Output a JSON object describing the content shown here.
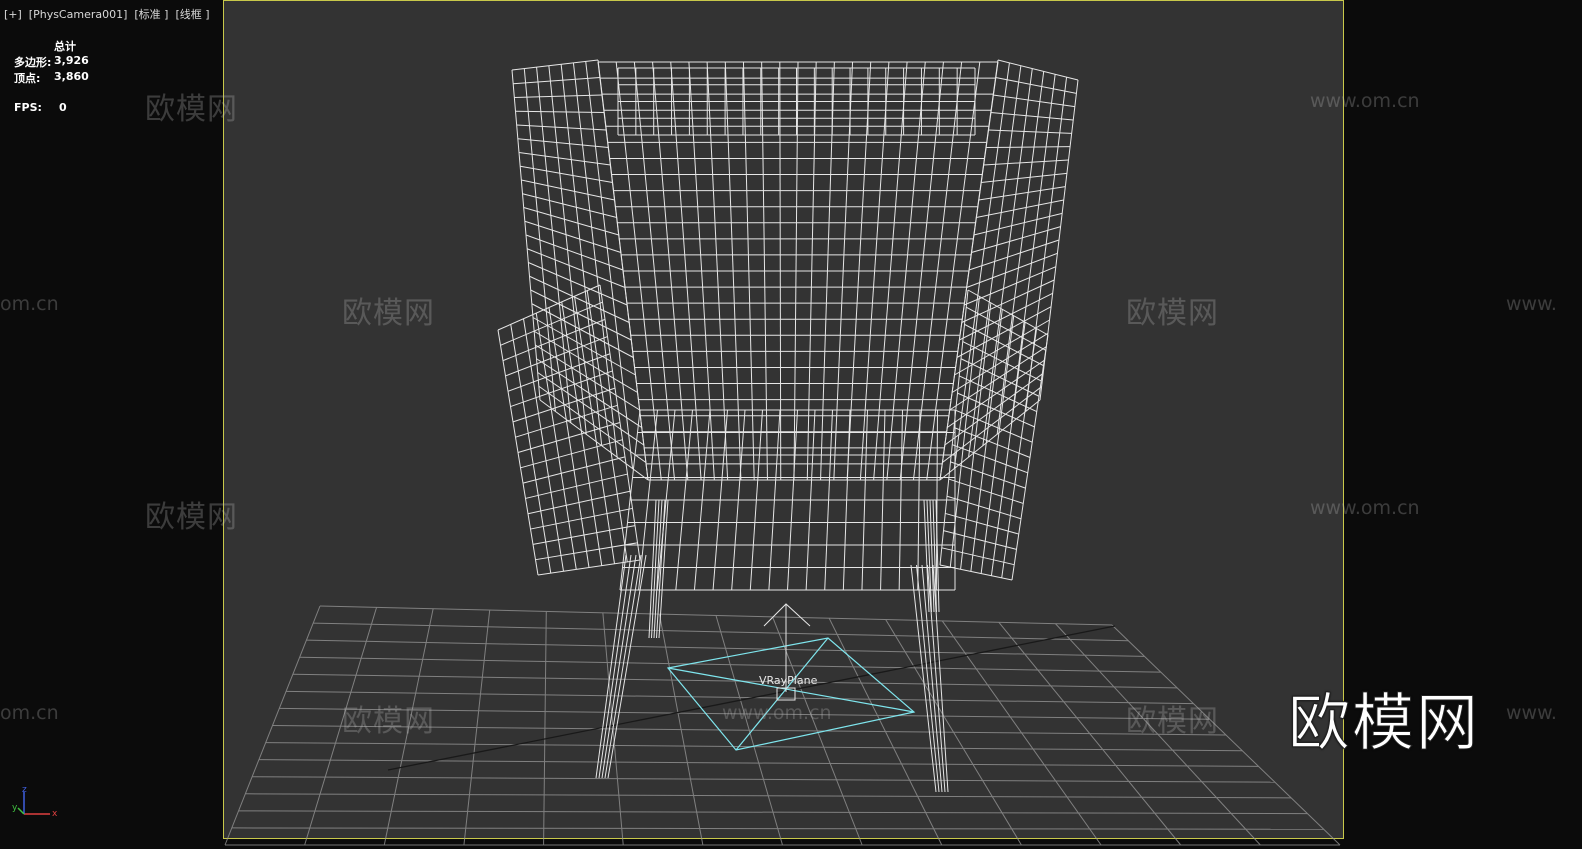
{
  "viewport": {
    "label": "[+]  [PhysCamera001]  [标准 ]  [线框 ]"
  },
  "stats": {
    "header": "总计",
    "polygons_label": "多边形:",
    "polygons_value": "3,926",
    "vertices_label": "顶点:",
    "vertices_value": "3,860",
    "fps_label": "FPS:",
    "fps_value": "0"
  },
  "scene": {
    "object_label": "VRayPlane"
  },
  "watermarks": {
    "cn": "欧模网",
    "url": "www.om.cn",
    "url_partial_left": "om.cn",
    "url_partial_right": "www."
  },
  "logo": {
    "text": "欧模网"
  },
  "axis": {
    "x": "x",
    "y": "y",
    "z": "z"
  },
  "colors": {
    "viewport_bg": "#333333",
    "outer_bg": "#0b0b0b",
    "safe_frame": "#c8c84a",
    "wireframe": "#e6e6e6",
    "grid": "#9a9a9a",
    "vray_plane": "#7fe6ee"
  }
}
